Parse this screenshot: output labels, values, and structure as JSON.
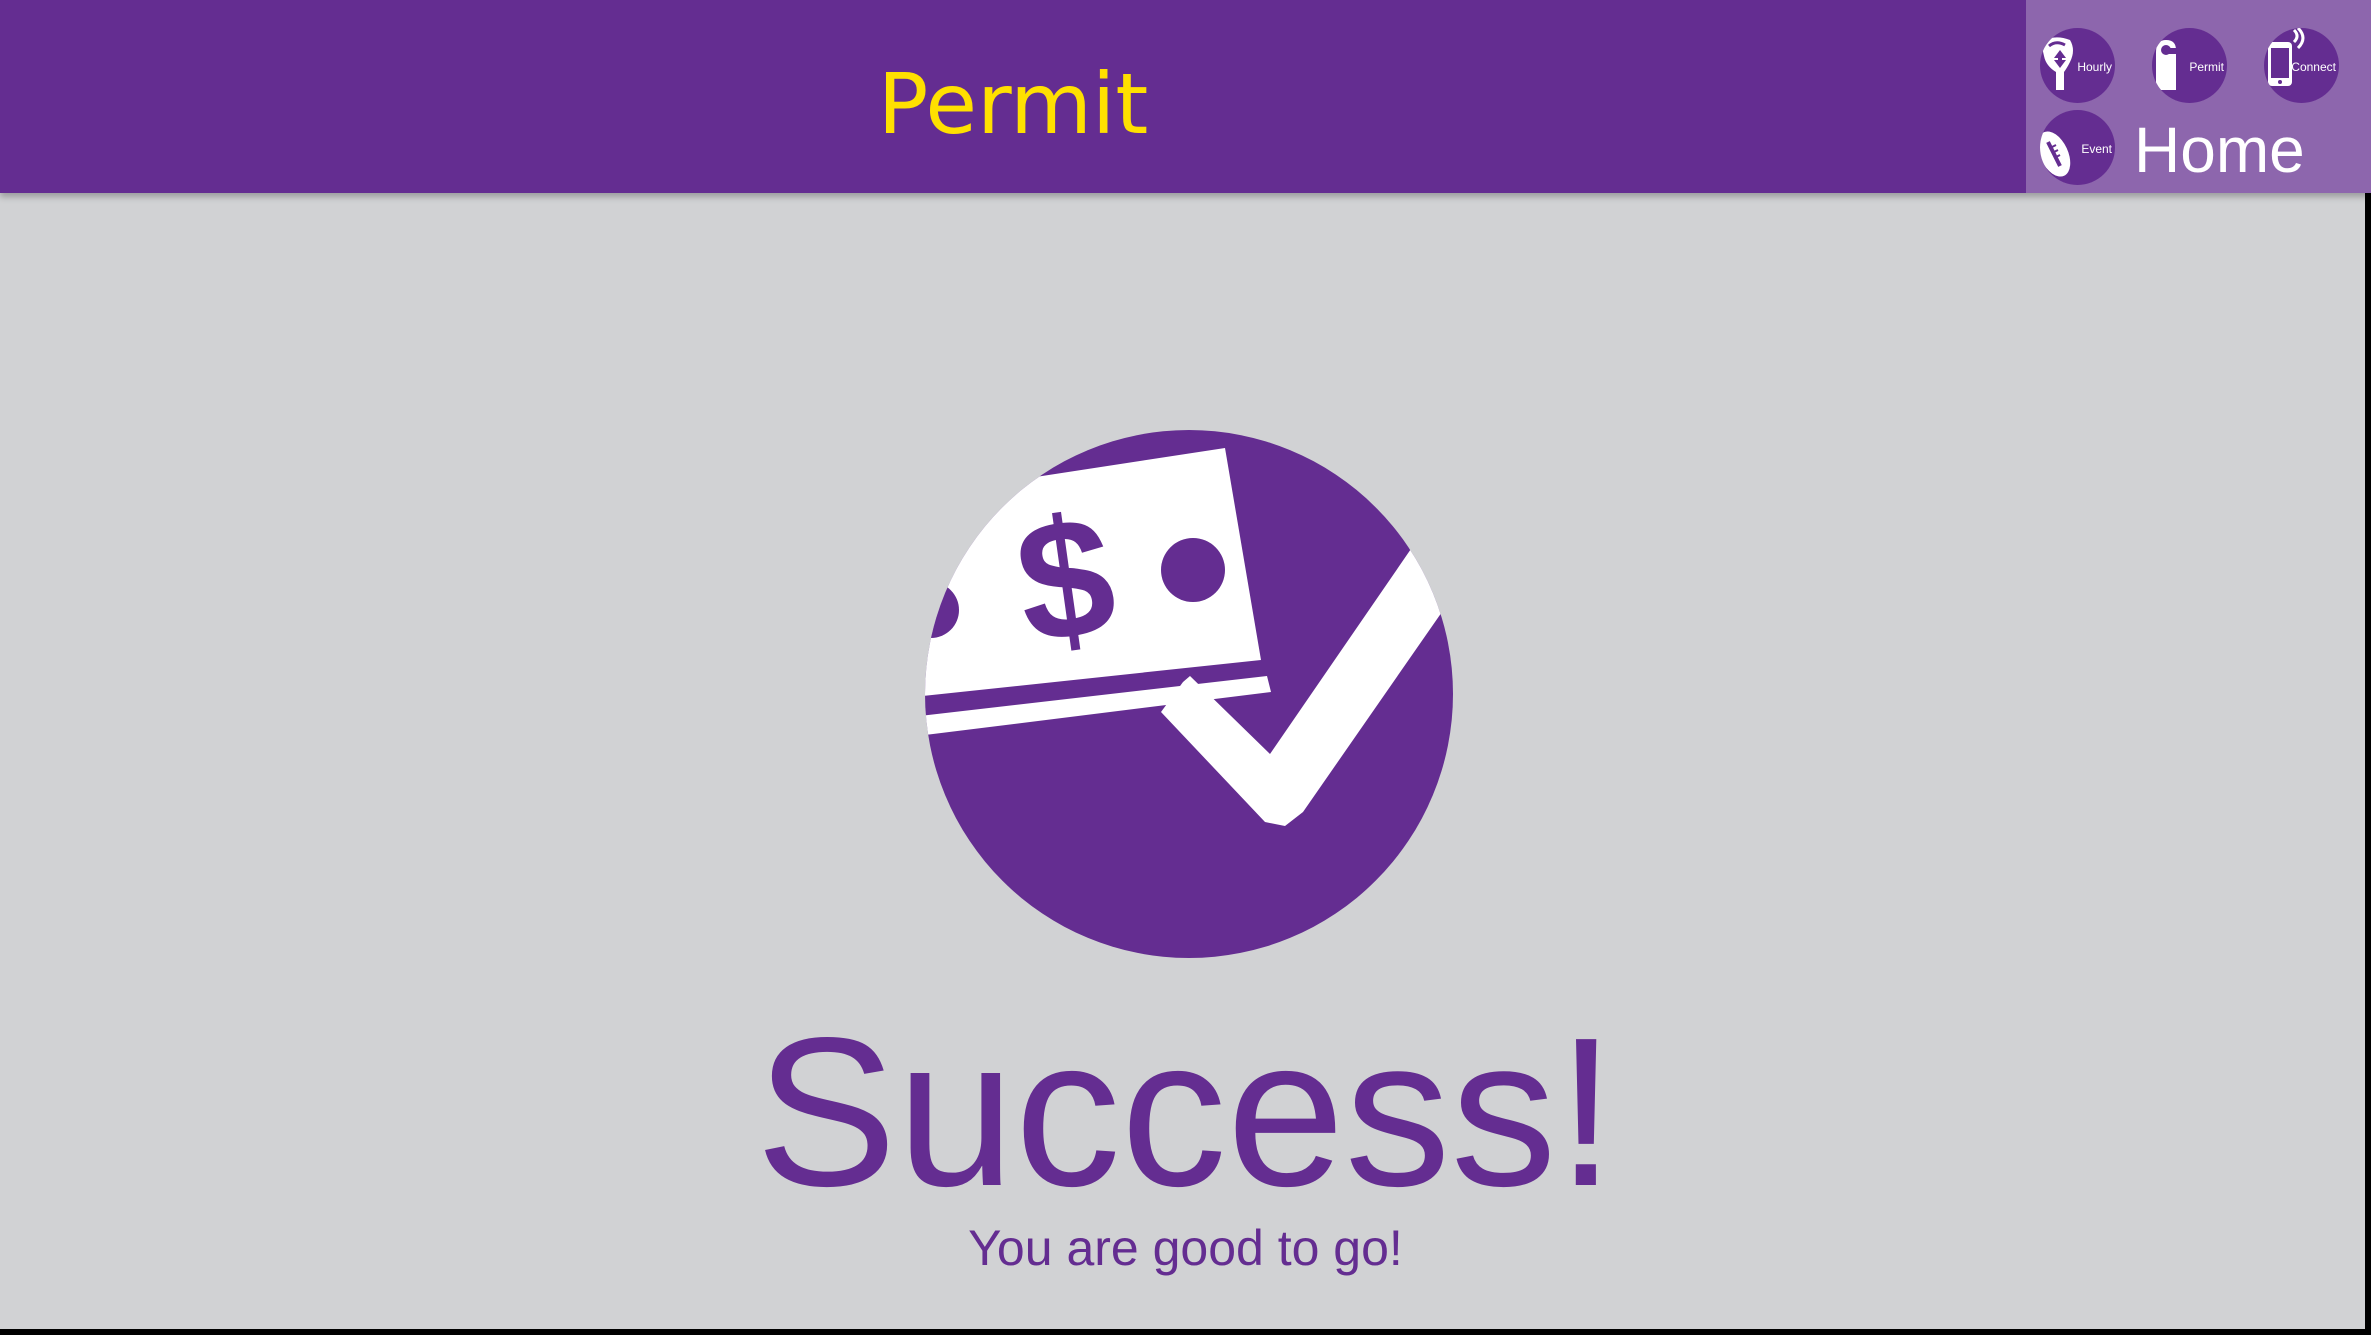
{
  "header": {
    "title": "Permit"
  },
  "nav": {
    "buttons": [
      {
        "label": "Hourly",
        "icon": "parking-meter-icon"
      },
      {
        "label": "Permit",
        "icon": "door-hanger-icon"
      },
      {
        "label": "Connect",
        "icon": "phone-signal-icon"
      },
      {
        "label": "Event",
        "icon": "football-icon"
      }
    ],
    "home_label": "Home"
  },
  "main": {
    "hero_icon": "money-check-icon",
    "title": "Success!",
    "subtitle": "You are good to go!"
  },
  "colors": {
    "brand_purple": "#642d91",
    "title_yellow": "#ffe000",
    "nav_panel": "#8d66ad",
    "background": "#d1d2d4"
  }
}
